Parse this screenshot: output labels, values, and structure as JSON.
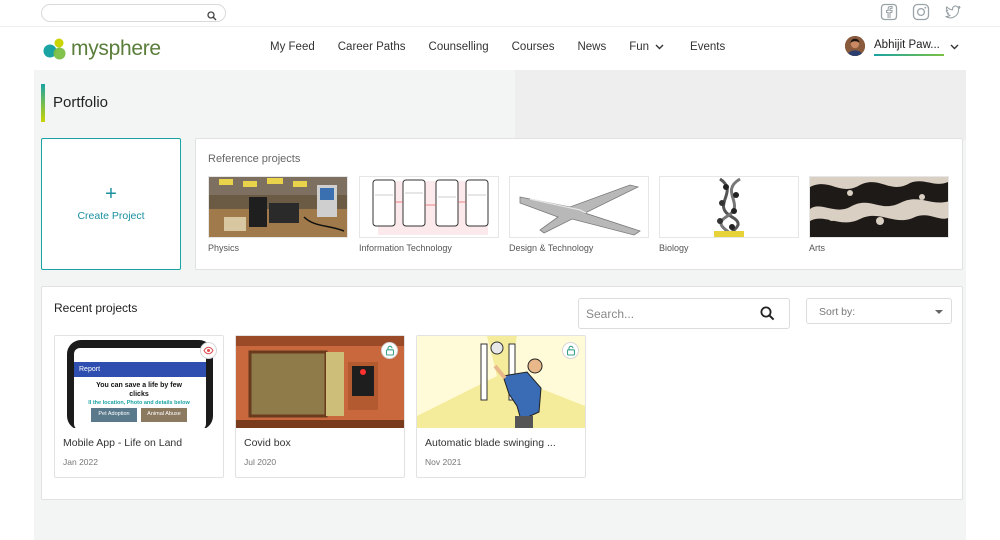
{
  "top": {
    "search_placeholder": "",
    "social_icons": [
      "facebook-icon",
      "instagram-icon",
      "twitter-icon"
    ]
  },
  "brand": {
    "name": "mysphere",
    "colors": {
      "teal": "#1aa3a3",
      "green": "#7bc043",
      "yellow": "#c9d400"
    }
  },
  "nav": {
    "items": [
      {
        "label": "My Feed"
      },
      {
        "label": "Career Paths"
      },
      {
        "label": "Counselling"
      },
      {
        "label": "Courses"
      },
      {
        "label": "News"
      },
      {
        "label": "Fun"
      },
      {
        "label": "Events"
      }
    ]
  },
  "user": {
    "name": "Abhijit Paw..."
  },
  "page": {
    "title": "Portfolio"
  },
  "create": {
    "plus": "+",
    "label": "Create Project"
  },
  "reference": {
    "title": "Reference projects",
    "items": [
      {
        "label": "Physics"
      },
      {
        "label": "Information Technology"
      },
      {
        "label": "Design & Technology"
      },
      {
        "label": "Biology"
      },
      {
        "label": "Arts"
      }
    ]
  },
  "recent": {
    "title": "Recent projects",
    "search_placeholder": "Search...",
    "sort_label": "Sort by:",
    "projects": [
      {
        "title": "Mobile App - Life on Land",
        "date": "Jan 2022",
        "badge": "eye-icon",
        "phone": {
          "header": "Report",
          "headline": "You can save a life by few clicks",
          "subline": "ll the location, Photo and details below",
          "btn1": "Pet Adoption",
          "btn2": "Animal Abuse"
        }
      },
      {
        "title": "Covid box",
        "date": "Jul 2020",
        "badge": "lock-icon"
      },
      {
        "title": "Automatic blade swinging ...",
        "date": "Nov 2021",
        "badge": "lock-icon"
      }
    ]
  }
}
